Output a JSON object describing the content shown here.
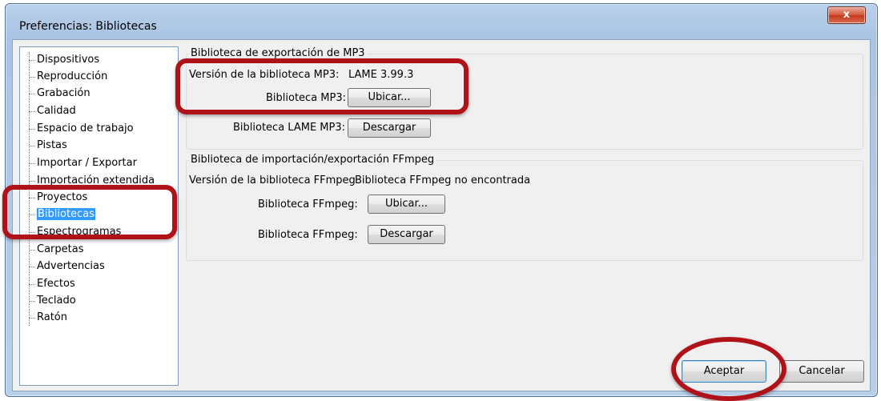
{
  "window": {
    "title": "Preferencias: Bibliotecas",
    "close_symbol": "x"
  },
  "sidebar": {
    "items": [
      {
        "label": "Dispositivos"
      },
      {
        "label": "Reproducción"
      },
      {
        "label": "Grabación"
      },
      {
        "label": "Calidad"
      },
      {
        "label": "Espacio de trabajo"
      },
      {
        "label": "Pistas"
      },
      {
        "label": "Importar / Exportar"
      },
      {
        "label": "Importación extendida"
      },
      {
        "label": "Proyectos"
      },
      {
        "label": "Bibliotecas"
      },
      {
        "label": "Espectrogramas"
      },
      {
        "label": "Carpetas"
      },
      {
        "label": "Advertencias"
      },
      {
        "label": "Efectos"
      },
      {
        "label": "Teclado"
      },
      {
        "label": "Ratón"
      }
    ],
    "selected": "Bibliotecas"
  },
  "mp3_group": {
    "title": "Biblioteca de exportación de MP3",
    "version_label": "Versión de la biblioteca MP3:",
    "version_value": "LAME 3.99.3",
    "library_label": "Biblioteca MP3:",
    "locate_button": "Ubicar...",
    "lame_label": "Biblioteca LAME MP3:",
    "download_button": "Descargar"
  },
  "ffmpeg_group": {
    "title": "Biblioteca de importación/exportación FFmpeg",
    "version_label": "Versión de la biblioteca FFmpeg",
    "version_value": "Biblioteca FFmpeg no encontrada",
    "library_label": "Biblioteca FFmpeg:",
    "locate_button": "Ubicar...",
    "download_label": "Biblioteca FFmpeg:",
    "download_button": "Descargar"
  },
  "footer": {
    "ok_button": "Aceptar",
    "cancel_button": "Cancelar"
  },
  "colors": {
    "selection": "#3399ff",
    "annotation": "#b01219"
  }
}
